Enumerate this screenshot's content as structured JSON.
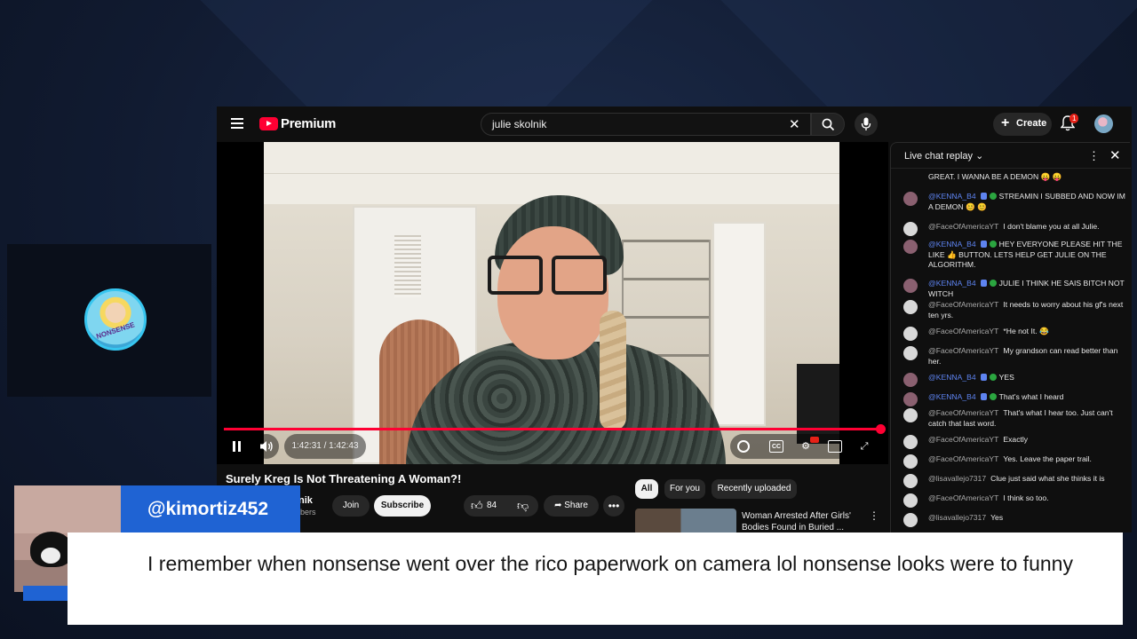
{
  "topbar": {
    "logo_text": "Premium",
    "search_value": "julie skolnik",
    "create_label": "Create",
    "notification_count": "1"
  },
  "player": {
    "time_display": "1:42:31 / 1:42:43",
    "progress_percent": 99.8,
    "cc_label": "CC"
  },
  "video": {
    "title": "Surely Kreg Is Not Threatening A Woman?!",
    "channel_name": "nik",
    "channel_subs": "ibers",
    "join_label": "Join",
    "subscribe_label": "Subscribe",
    "like_count": "84",
    "share_label": "Share"
  },
  "recommendations": {
    "chips": [
      "All",
      "For you",
      "Recently uploaded"
    ],
    "items": [
      {
        "title": "Woman Arrested After Girls' Bodies Found in Buried ..."
      }
    ]
  },
  "chat": {
    "title": "Live chat replay",
    "messages": [
      {
        "author": "",
        "text": "GREAT. I WANNA BE A DEMON 😛 😛",
        "mod": false,
        "avatar": "none"
      },
      {
        "author": "@KENNA_B4",
        "text": "STREAMIN I SUBBED AND NOW IM A DEMON 😊 😊",
        "mod": true,
        "avatar": "a"
      },
      {
        "author": "@FaceOfAmericaYT",
        "text": "I don't blame you at all Julie.",
        "mod": false,
        "avatar": "b"
      },
      {
        "author": "@KENNA_B4",
        "text": "HEY EVERYONE PLEASE HIT THE LIKE 👍 BUTTON. LETS HELP GET JULIE ON THE ALGORITHM.",
        "mod": true,
        "avatar": "a"
      },
      {
        "author": "@KENNA_B4",
        "text": "JULIE I THINK HE SAIS BITCH NOT WITCH",
        "mod": true,
        "avatar": "a"
      },
      {
        "author": "@FaceOfAmericaYT",
        "text": "It needs to worry about his gf's next ten yrs.",
        "mod": false,
        "avatar": "b"
      },
      {
        "author": "@FaceOfAmericaYT",
        "text": "*He not It. 😂",
        "mod": false,
        "avatar": "b"
      },
      {
        "author": "@FaceOfAmericaYT",
        "text": "My grandson can read better than her.",
        "mod": false,
        "avatar": "b"
      },
      {
        "author": "@KENNA_B4",
        "text": "YES",
        "mod": true,
        "avatar": "a"
      },
      {
        "author": "@KENNA_B4",
        "text": "That's what I heard",
        "mod": true,
        "avatar": "a"
      },
      {
        "author": "@FaceOfAmericaYT",
        "text": "That's what I hear too. Just can't catch that last word.",
        "mod": false,
        "avatar": "b"
      },
      {
        "author": "@FaceOfAmericaYT",
        "text": "Exactly",
        "mod": false,
        "avatar": "b"
      },
      {
        "author": "@FaceOfAmericaYT",
        "text": "Yes. Leave the paper trail.",
        "mod": false,
        "avatar": "b"
      },
      {
        "author": "@lisavallejo7317",
        "text": "Clue just said what she thinks it is",
        "mod": false,
        "avatar": "b"
      },
      {
        "author": "@FaceOfAmericaYT",
        "text": "I think so too.",
        "mod": false,
        "avatar": "b"
      },
      {
        "author": "@lisavallejo7317",
        "text": "Yes",
        "mod": false,
        "avatar": "b"
      }
    ]
  },
  "overlay": {
    "username": "@kimortiz452",
    "comment": "I remember when nonsense went over the rico paperwork on camera lol nonsense looks were to funny",
    "cam_avatar_text": "NONSENSE"
  },
  "colors": {
    "accent_red": "#ff0033",
    "overlay_blue": "#1f63d3",
    "mod_blue": "#5e84f1"
  }
}
